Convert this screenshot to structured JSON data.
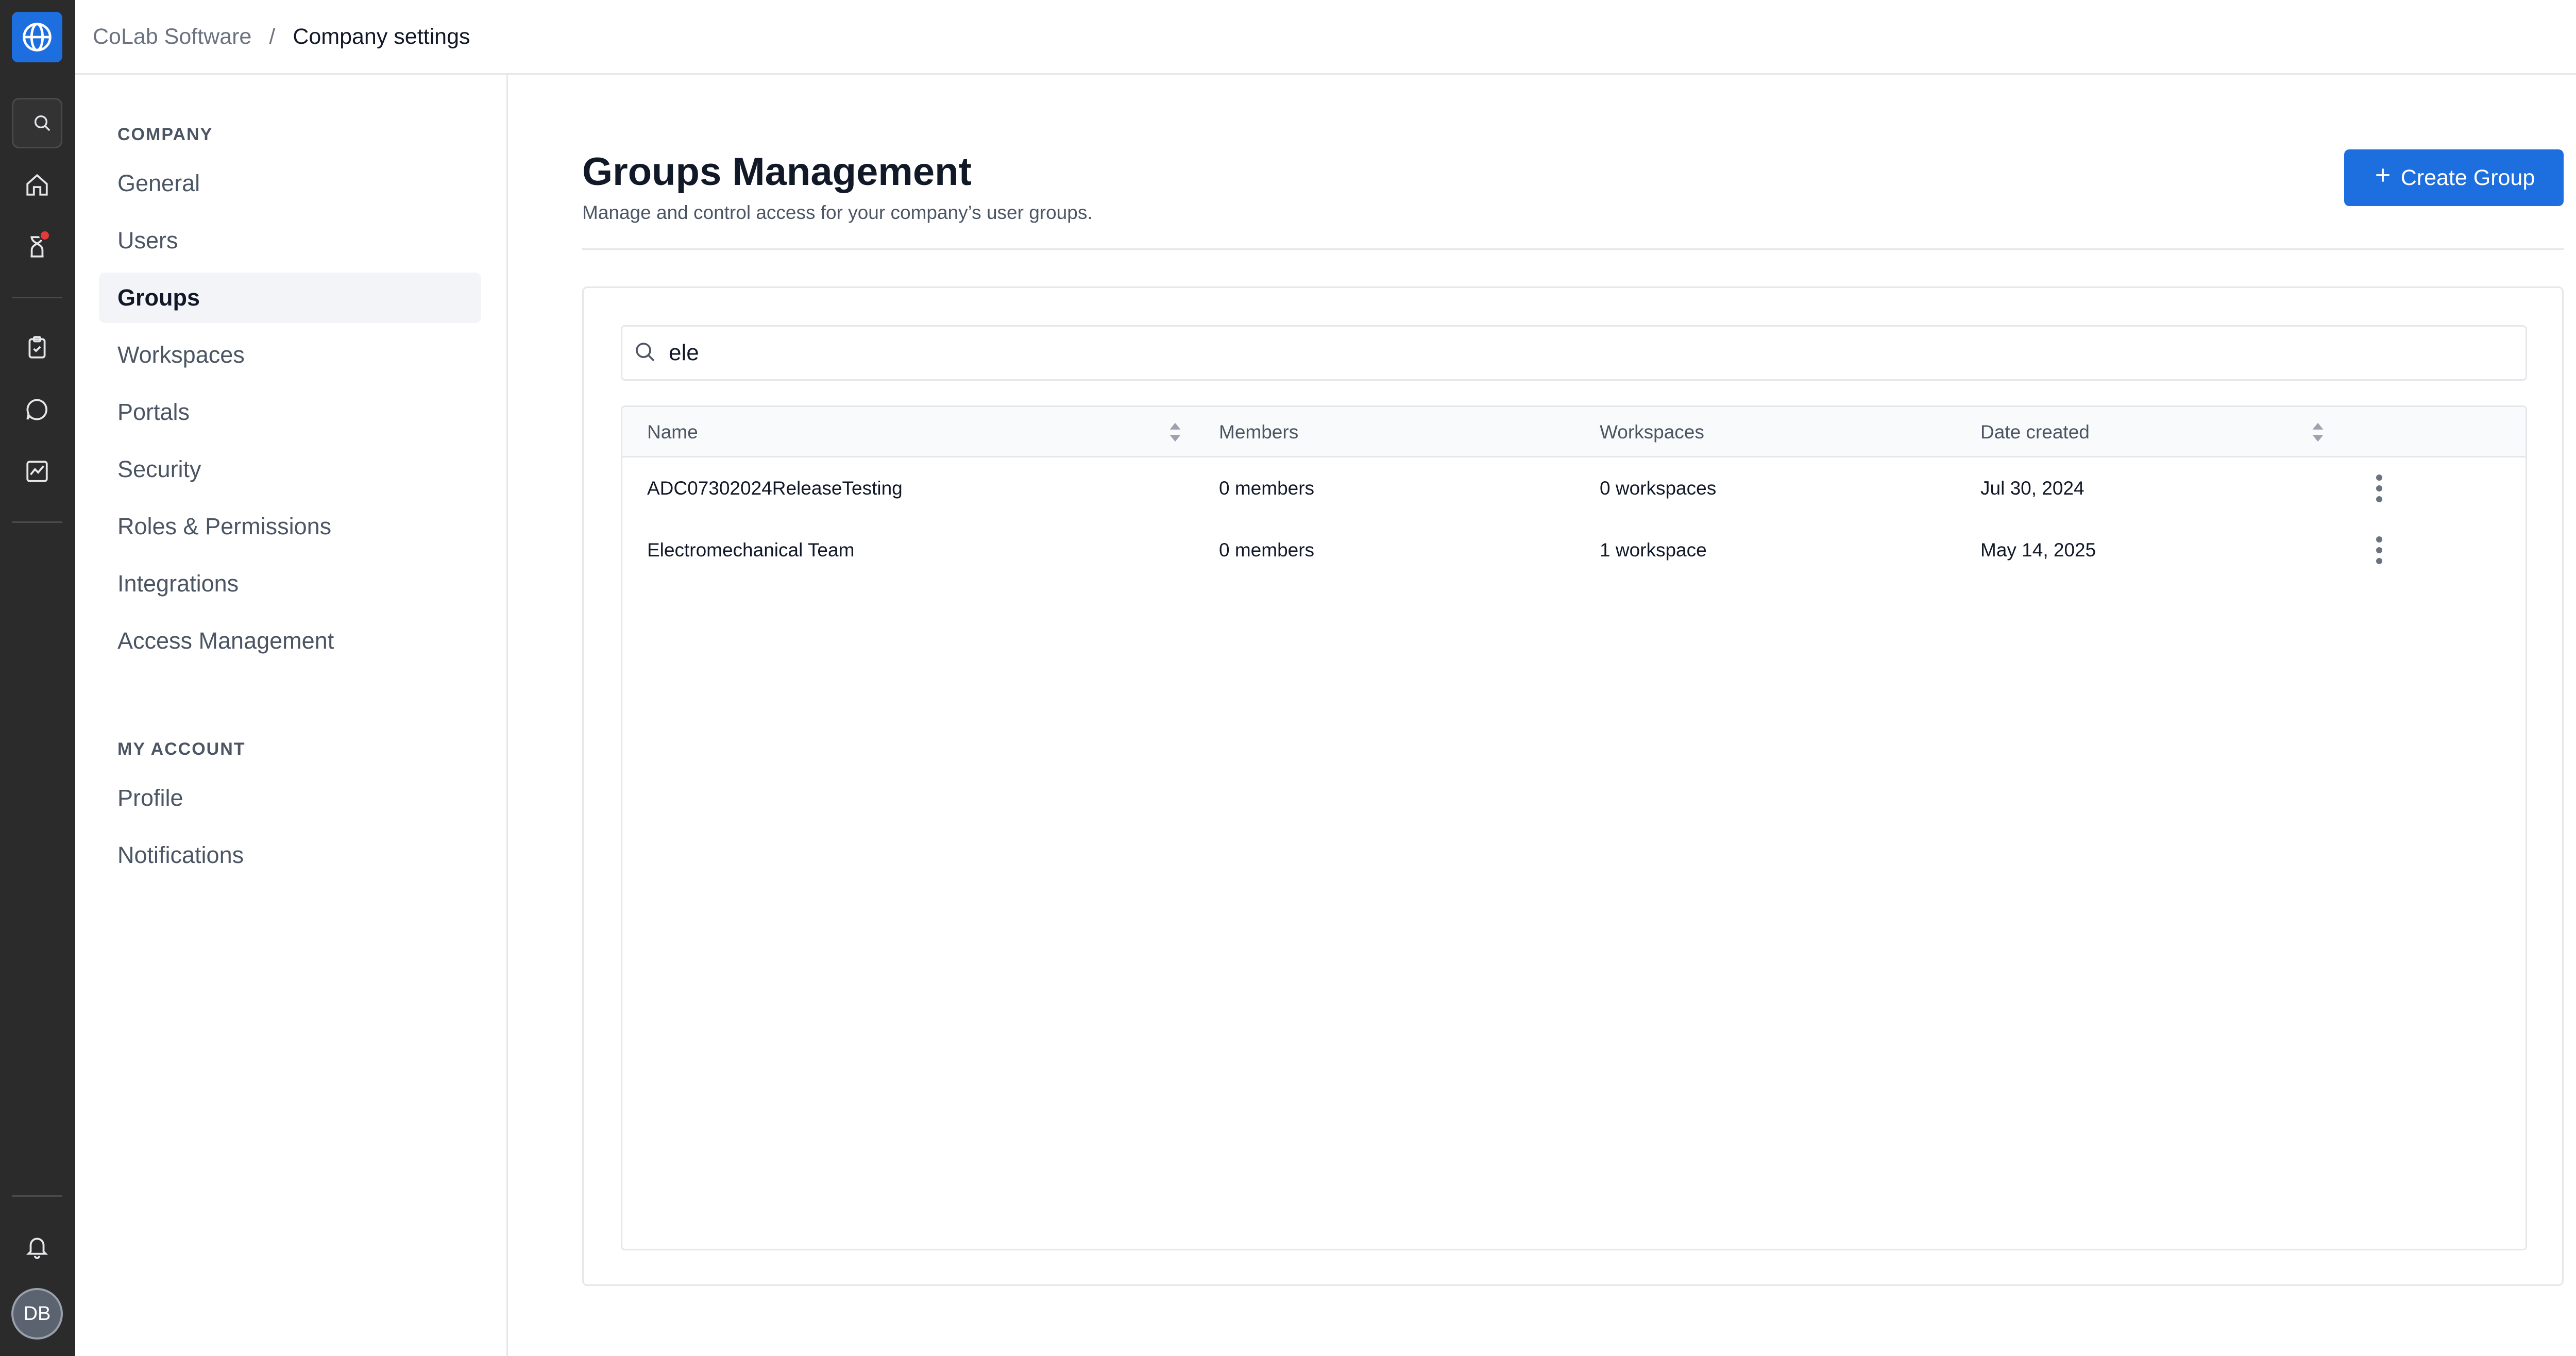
{
  "colors": {
    "accent": "#1d6fe0",
    "rail_bg": "#2b2b2b",
    "notification_dot": "#e23b3b"
  },
  "rail": {
    "icons": [
      "globe-icon",
      "search-icon",
      "home-icon",
      "hourglass-icon",
      "clipboard-check-icon",
      "chat-icon",
      "chart-icon",
      "bell-icon"
    ],
    "avatar_initials": "DB"
  },
  "breadcrumb": {
    "root": "CoLab Software",
    "separator": "/",
    "current": "Company settings"
  },
  "settings_nav": {
    "company_heading": "COMPANY",
    "company_items": [
      {
        "label": "General"
      },
      {
        "label": "Users"
      },
      {
        "label": "Groups",
        "active": true
      },
      {
        "label": "Workspaces"
      },
      {
        "label": "Portals"
      },
      {
        "label": "Security"
      },
      {
        "label": "Roles & Permissions"
      },
      {
        "label": "Integrations"
      },
      {
        "label": "Access Management"
      }
    ],
    "account_heading": "MY ACCOUNT",
    "account_items": [
      {
        "label": "Profile"
      },
      {
        "label": "Notifications"
      }
    ]
  },
  "page": {
    "title": "Groups Management",
    "subtitle": "Manage and control access for your company’s user groups.",
    "create_button": "Create Group"
  },
  "search": {
    "value": "ele"
  },
  "table": {
    "columns": [
      "Name",
      "Members",
      "Workspaces",
      "Date created"
    ],
    "rows": [
      {
        "name": "ADC07302024ReleaseTesting",
        "members": "0 members",
        "workspaces": "0 workspaces",
        "date": "Jul 30, 2024"
      },
      {
        "name": "Electromechanical Team",
        "members": "0 members",
        "workspaces": "1 workspace",
        "date": "May 14, 2025"
      }
    ]
  }
}
